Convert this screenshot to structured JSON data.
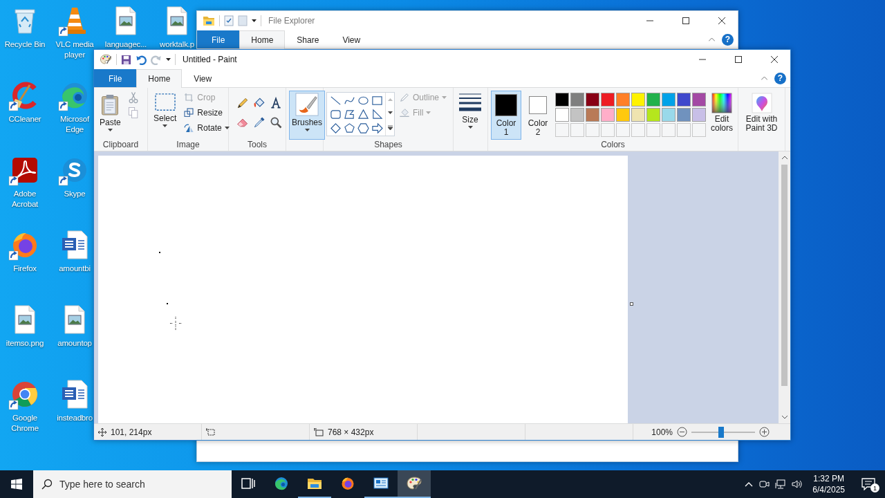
{
  "desktop_icon_columns": [
    [
      {
        "label": "Recycle Bin",
        "kind": "recycle",
        "shortcut": false
      },
      {
        "label": "CCleaner",
        "kind": "ccleaner",
        "shortcut": true
      },
      {
        "label": "Adobe Acrobat",
        "kind": "acrobat",
        "shortcut": true
      },
      {
        "label": "Firefox",
        "kind": "firefox",
        "shortcut": true
      },
      {
        "label": "itemso.png",
        "kind": "image",
        "shortcut": false
      },
      {
        "label": "Google Chrome",
        "kind": "chrome",
        "shortcut": true
      }
    ],
    [
      {
        "label": "VLC media player",
        "kind": "vlc",
        "shortcut": true
      },
      {
        "label": "Microsof Edge",
        "kind": "edge",
        "shortcut": true
      },
      {
        "label": "Skype",
        "kind": "skype",
        "shortcut": true
      },
      {
        "label": "amountbi",
        "kind": "word",
        "shortcut": false
      },
      {
        "label": "amountop",
        "kind": "image",
        "shortcut": false
      },
      {
        "label": "insteadbro",
        "kind": "word",
        "shortcut": false
      }
    ],
    [
      {
        "label": "languagec...",
        "kind": "image",
        "shortcut": false
      }
    ],
    [
      {
        "label": "worktalk.p",
        "kind": "image",
        "shortcut": false
      }
    ]
  ],
  "explorer_window": {
    "title": "File Explorer",
    "help": "?",
    "tabs": [
      {
        "label": "File",
        "kind": "file",
        "selected": false
      },
      {
        "label": "Home",
        "kind": "tab",
        "selected": true
      },
      {
        "label": "Share",
        "kind": "tab",
        "selected": false
      },
      {
        "label": "View",
        "kind": "tab",
        "selected": false
      }
    ]
  },
  "paint_window": {
    "title": "Untitled - Paint",
    "help": "?",
    "tabs": [
      {
        "label": "File",
        "kind": "file",
        "selected": false
      },
      {
        "label": "Home",
        "kind": "tab",
        "selected": true
      },
      {
        "label": "View",
        "kind": "tab",
        "selected": false
      }
    ],
    "ribbon": {
      "clipboard": {
        "label": "Clipboard",
        "paste": "Paste"
      },
      "image": {
        "label": "Image",
        "select": "Select",
        "crop": {
          "label": "Crop",
          "disabled": true
        },
        "resize": {
          "label": "Resize",
          "disabled": false
        },
        "rotate": {
          "label": "Rotate",
          "disabled": false
        }
      },
      "tools": {
        "label": "Tools"
      },
      "brushes": {
        "label": "Brushes",
        "selected": true
      },
      "shapes": {
        "label": "Shapes",
        "outline": {
          "label": "Outline",
          "disabled": true
        },
        "fill": {
          "label": "Fill",
          "disabled": true
        }
      },
      "size": {
        "label": "Size"
      },
      "colors": {
        "label": "Colors",
        "color1": {
          "label": "Color 1",
          "color": "#000000",
          "selected": true
        },
        "color2": {
          "label": "Color 2",
          "color": "#ffffff",
          "selected": false
        },
        "palette": [
          {
            "kind": "swatch",
            "color": "#000000"
          },
          {
            "kind": "swatch",
            "color": "#7f7f7f"
          },
          {
            "kind": "swatch",
            "color": "#880015"
          },
          {
            "kind": "swatch",
            "color": "#ed1c24"
          },
          {
            "kind": "swatch",
            "color": "#ff7f27"
          },
          {
            "kind": "swatch",
            "color": "#fff200"
          },
          {
            "kind": "swatch",
            "color": "#22b14c"
          },
          {
            "kind": "swatch",
            "color": "#00a2e8"
          },
          {
            "kind": "swatch",
            "color": "#3f48cc"
          },
          {
            "kind": "swatch",
            "color": "#a349a4"
          },
          {
            "kind": "swatch",
            "color": "#ffffff"
          },
          {
            "kind": "swatch",
            "color": "#c3c3c3"
          },
          {
            "kind": "swatch",
            "color": "#b97a57"
          },
          {
            "kind": "swatch",
            "color": "#ffaec9"
          },
          {
            "kind": "swatch",
            "color": "#ffc90e"
          },
          {
            "kind": "swatch",
            "color": "#efe4b0"
          },
          {
            "kind": "swatch",
            "color": "#b5e61d"
          },
          {
            "kind": "swatch",
            "color": "#99d9ea"
          },
          {
            "kind": "swatch",
            "color": "#7092be"
          },
          {
            "kind": "swatch",
            "color": "#c8bfe7"
          },
          {
            "kind": "empty"
          },
          {
            "kind": "empty"
          },
          {
            "kind": "empty"
          },
          {
            "kind": "empty"
          },
          {
            "kind": "empty"
          },
          {
            "kind": "empty"
          },
          {
            "kind": "empty"
          },
          {
            "kind": "empty"
          },
          {
            "kind": "empty"
          },
          {
            "kind": "empty"
          }
        ],
        "edit": "Edit colors"
      },
      "paint3d": {
        "label": "Edit with Paint 3D"
      }
    },
    "status_bar": {
      "position": "101, 214px",
      "canvas_size": "768 × 432px",
      "zoom": "100%",
      "zoom_slider": {
        "level": 0.47
      }
    }
  },
  "taskbar": {
    "search": {
      "placeholder": "Type here to search"
    },
    "apps": [
      {
        "kind": "taskview",
        "running": false,
        "selected": false
      },
      {
        "kind": "edge",
        "running": false,
        "selected": false
      },
      {
        "kind": "explorer",
        "running": true,
        "selected": false
      },
      {
        "kind": "firefox",
        "running": false,
        "selected": false
      },
      {
        "kind": "monitor",
        "running": true,
        "selected": false
      },
      {
        "kind": "paint",
        "running": true,
        "selected": true
      }
    ],
    "clock": {
      "time": "1:32 PM",
      "date": "6/4/2025"
    },
    "notifications": {
      "count": "1"
    }
  }
}
